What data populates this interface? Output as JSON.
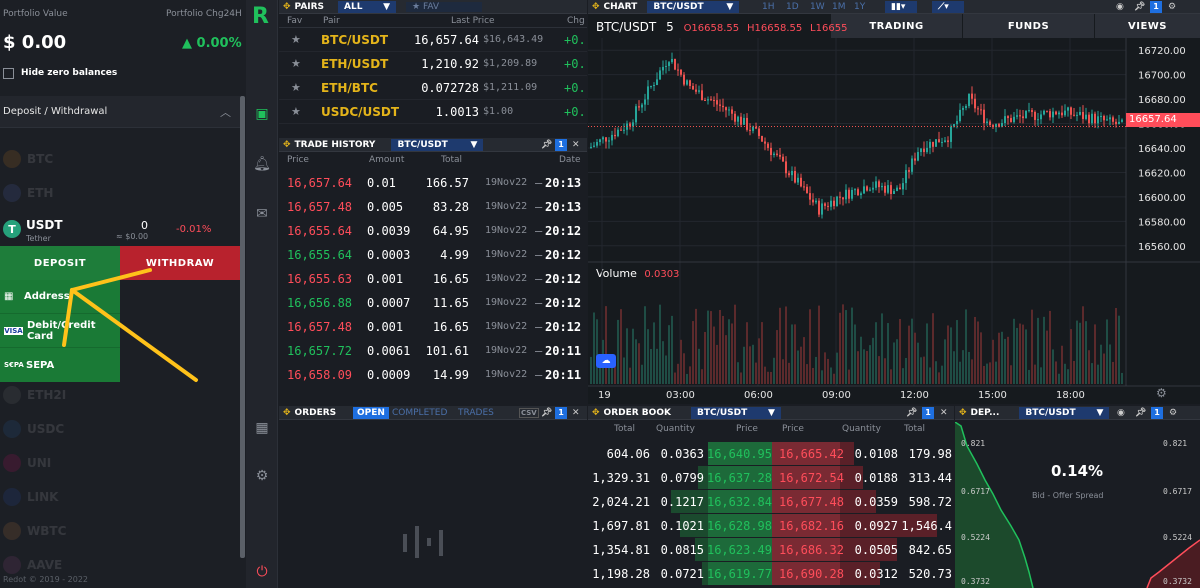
{
  "portfolio": {
    "value_label": "Portfolio Value",
    "chg_label": "Portfolio Chg24H",
    "value": "$ 0.00",
    "chg": "▲ 0.00%",
    "hide_zero": "Hide zero balances",
    "section": "Deposit / Withdrawal",
    "coins_dim_top": [
      "BTC",
      "ETH"
    ],
    "usdt": {
      "symbol": "USDT",
      "name": "Tether",
      "amount": "0",
      "usd": "≈ $0.00",
      "chg": "-0.01%"
    },
    "deposit": "DEPOSIT",
    "withdraw": "WITHDRAW",
    "menu": [
      {
        "label": "Address",
        "icon": "address-icon"
      },
      {
        "label": "Debit/Credit Card",
        "icon": "visa-card-icon"
      },
      {
        "label": "SEPA",
        "icon": "sepa-icon"
      }
    ],
    "coins_dim_bottom": [
      "ETH2I",
      "USDC",
      "UNI",
      "LINK",
      "WBTC",
      "AAVE"
    ],
    "footer": "Redot © 2019 - 2022"
  },
  "rail": {
    "logo": "R"
  },
  "pairs": {
    "title": "PAIRS",
    "filter": "ALL",
    "fav_tab": "★ FAV",
    "headers": [
      "Fav",
      "Pair",
      "Last Price",
      "Chg"
    ],
    "rows": [
      {
        "pair": "BTC/USDT",
        "price": "16,657.64",
        "usd": "$16,643.49",
        "chg": "+0."
      },
      {
        "pair": "ETH/USDT",
        "price": "1,210.92",
        "usd": "$1,209.89",
        "chg": "+0."
      },
      {
        "pair": "ETH/BTC",
        "price": "0.072728",
        "usd": "$1,211.09",
        "chg": "+0."
      },
      {
        "pair": "USDC/USDT",
        "price": "1.0013",
        "usd": "$1.00",
        "chg": "+0."
      }
    ]
  },
  "trades": {
    "title": "TRADE HISTORY",
    "pair": "BTC/USDT",
    "headers": [
      "Price",
      "Amount",
      "Total",
      "Date"
    ],
    "rows": [
      {
        "price": "16,657.64",
        "amount": "0.01",
        "total": "166.57",
        "date": "19Nov22",
        "time": "20:13",
        "side": "red"
      },
      {
        "price": "16,657.48",
        "amount": "0.005",
        "total": "83.28",
        "date": "19Nov22",
        "time": "20:13",
        "side": "red"
      },
      {
        "price": "16,655.64",
        "amount": "0.0039",
        "total": "64.95",
        "date": "19Nov22",
        "time": "20:12",
        "side": "red"
      },
      {
        "price": "16,655.64",
        "amount": "0.0003",
        "total": "4.99",
        "date": "19Nov22",
        "time": "20:12",
        "side": "green"
      },
      {
        "price": "16,655.63",
        "amount": "0.001",
        "total": "16.65",
        "date": "19Nov22",
        "time": "20:12",
        "side": "red"
      },
      {
        "price": "16,656.88",
        "amount": "0.0007",
        "total": "11.65",
        "date": "19Nov22",
        "time": "20:12",
        "side": "green"
      },
      {
        "price": "16,657.48",
        "amount": "0.001",
        "total": "16.65",
        "date": "19Nov22",
        "time": "20:12",
        "side": "red"
      },
      {
        "price": "16,657.72",
        "amount": "0.0061",
        "total": "101.61",
        "date": "19Nov22",
        "time": "20:11",
        "side": "green"
      },
      {
        "price": "16,658.09",
        "amount": "0.0009",
        "total": "14.99",
        "date": "19Nov22",
        "time": "20:11",
        "side": "red"
      }
    ]
  },
  "orders": {
    "title": "ORDERS",
    "tabs": [
      "OPEN",
      "COMPLETED",
      "TRADES"
    ],
    "csv": "CSV"
  },
  "chart": {
    "title": "CHART",
    "pair": "BTC/USDT",
    "intervals": [
      "1H",
      "1D",
      "1W",
      "1M",
      "1Y"
    ],
    "symbol": "BTC/USDT",
    "timeframe": "5",
    "ohlc_o": "O16658.55",
    "ohlc_h": "H16658.55",
    "ohlc_l": "L16655",
    "tabs": [
      "TRADING",
      "FUNDS",
      "VIEWS"
    ],
    "volume_label": "Volume",
    "volume_value": "0.0303",
    "last_price": "16657.64",
    "price_ticks": [
      "16720.00",
      "16700.00",
      "16680.00",
      "16660.00",
      "16640.00",
      "16620.00",
      "16600.00",
      "16580.00",
      "16560.00"
    ],
    "time_ticks": [
      "19",
      "03:00",
      "06:00",
      "09:00",
      "12:00",
      "15:00",
      "18:00"
    ]
  },
  "orderbook": {
    "title": "ORDER BOOK",
    "pair": "BTC/USDT",
    "headers": [
      "Total",
      "Quantity",
      "Price",
      "Price",
      "Quantity",
      "Total"
    ],
    "bids": [
      {
        "total": "604.06",
        "qty": "0.0363",
        "price": "16,640.95",
        "depth": 0.25
      },
      {
        "total": "1,329.31",
        "qty": "0.0799",
        "price": "16,637.28",
        "depth": 0.4
      },
      {
        "total": "2,024.21",
        "qty": "0.1217",
        "price": "16,632.84",
        "depth": 0.55
      },
      {
        "total": "1,697.81",
        "qty": "0.1021",
        "price": "16,628.98",
        "depth": 0.5
      },
      {
        "total": "1,354.81",
        "qty": "0.0815",
        "price": "16,623.49",
        "depth": 0.42
      },
      {
        "total": "1,198.28",
        "qty": "0.0721",
        "price": "16,619.77",
        "depth": 0.38
      }
    ],
    "asks": [
      {
        "price": "16,665.42",
        "qty": "0.0108",
        "total": "179.98",
        "depth": 0.12
      },
      {
        "price": "16,672.54",
        "qty": "0.0188",
        "total": "313.44",
        "depth": 0.2
      },
      {
        "price": "16,677.48",
        "qty": "0.0359",
        "total": "598.72",
        "depth": 0.32
      },
      {
        "price": "16,682.16",
        "qty": "0.0927",
        "total": "1,546.4",
        "depth": 0.85
      },
      {
        "price": "16,686.32",
        "qty": "0.0505",
        "total": "842.65",
        "depth": 0.5
      },
      {
        "price": "16,690.28",
        "qty": "0.0312",
        "total": "520.73",
        "depth": 0.35
      }
    ]
  },
  "depth": {
    "title": "DEP...",
    "pair": "BTC/USDT",
    "spread": "0.14%",
    "spread_label": "Bid - Offer Spread",
    "left_ticks": [
      "0.821",
      "0.6717",
      "0.5224",
      "0.3732"
    ],
    "right_ticks": [
      "0.821",
      "0.6717",
      "0.5224",
      "0.3732"
    ]
  }
}
